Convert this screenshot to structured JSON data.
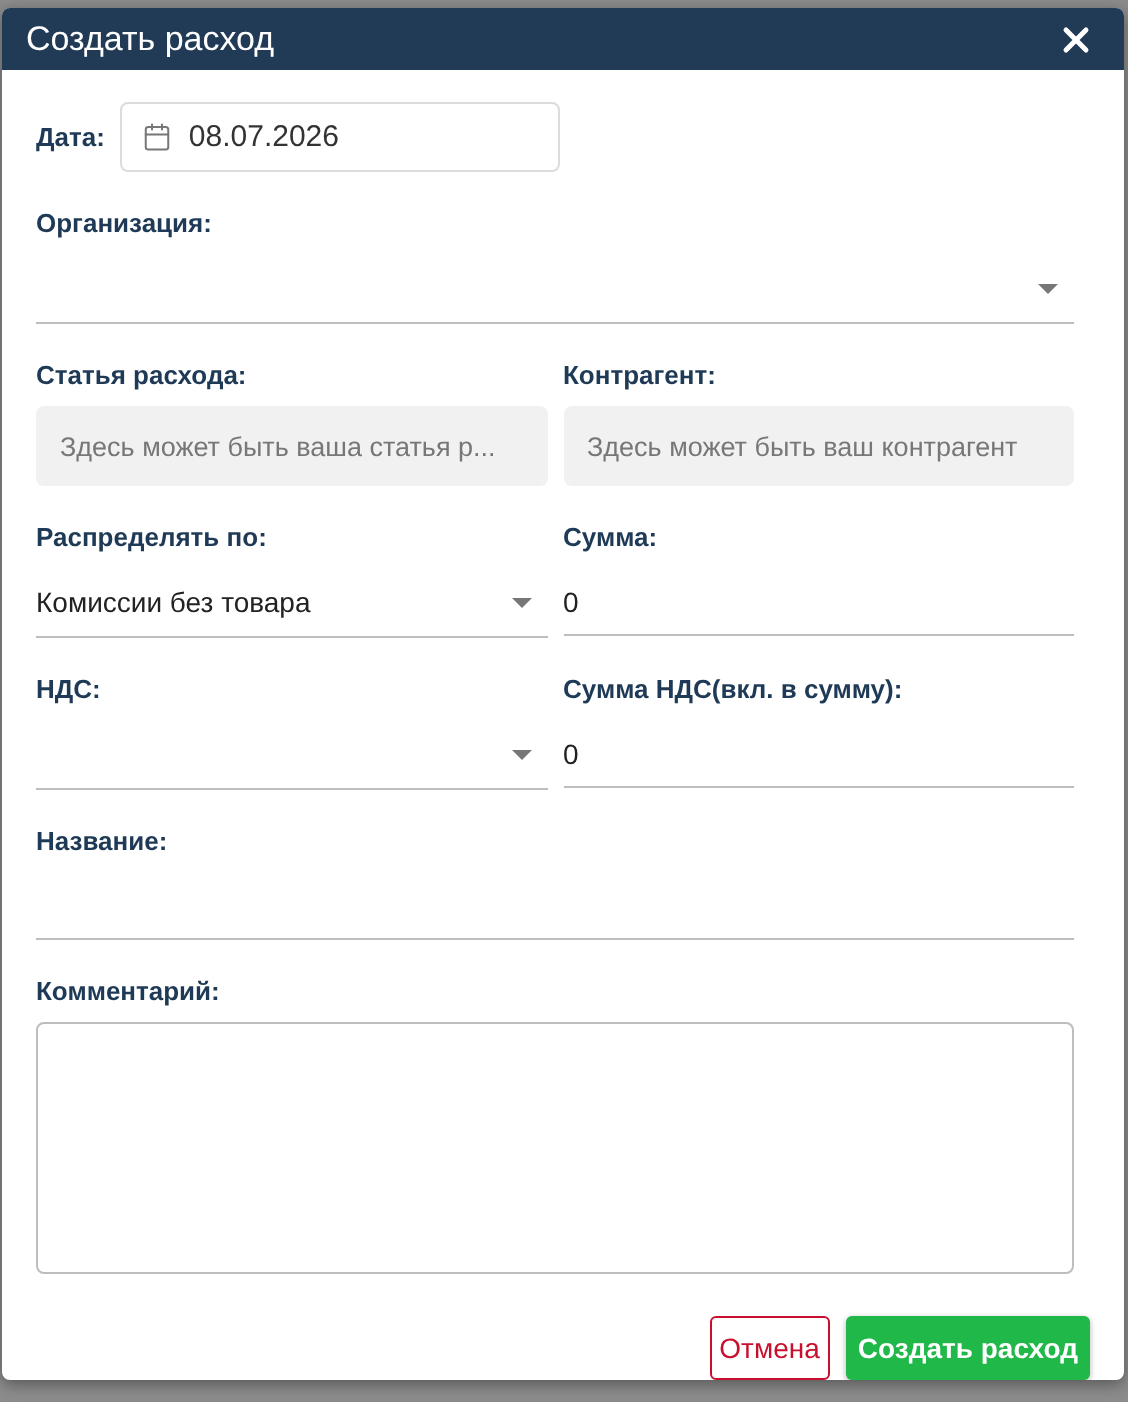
{
  "dialog": {
    "title": "Создать расход"
  },
  "rows": [
    {
      "fields": [
        {
          "kind": "date",
          "label": "Дата:",
          "value": "08.07.2026"
        }
      ]
    },
    {
      "fields": [
        {
          "kind": "select",
          "label": "Организация:"
        }
      ]
    },
    {
      "fields": [
        {
          "kind": "filled",
          "label": "Статья расхода:",
          "placeholder": "Здесь может быть ваша статья р..."
        },
        {
          "kind": "filled",
          "label": "Контрагент:",
          "placeholder": "Здесь может быть ваш контрагент"
        }
      ]
    },
    {
      "fields": [
        {
          "kind": "select",
          "label": "Распределять по:",
          "value": "Комиссии без товара"
        },
        {
          "kind": "text",
          "label": "Сумма:",
          "value": "0"
        }
      ]
    },
    {
      "fields": [
        {
          "kind": "select",
          "label": "НДС:"
        },
        {
          "kind": "text",
          "label": "Сумма НДС(вкл. в сумму):",
          "value": "0"
        }
      ]
    },
    {
      "fields": [
        {
          "kind": "text",
          "label": "Название:"
        }
      ]
    },
    {
      "fields": [
        {
          "kind": "textarea",
          "label": "Комментарий:"
        }
      ]
    }
  ],
  "buttons": [
    {
      "kind": "cancel",
      "label": "Отмена"
    },
    {
      "kind": "primary",
      "label": "Создать расход"
    }
  ]
}
